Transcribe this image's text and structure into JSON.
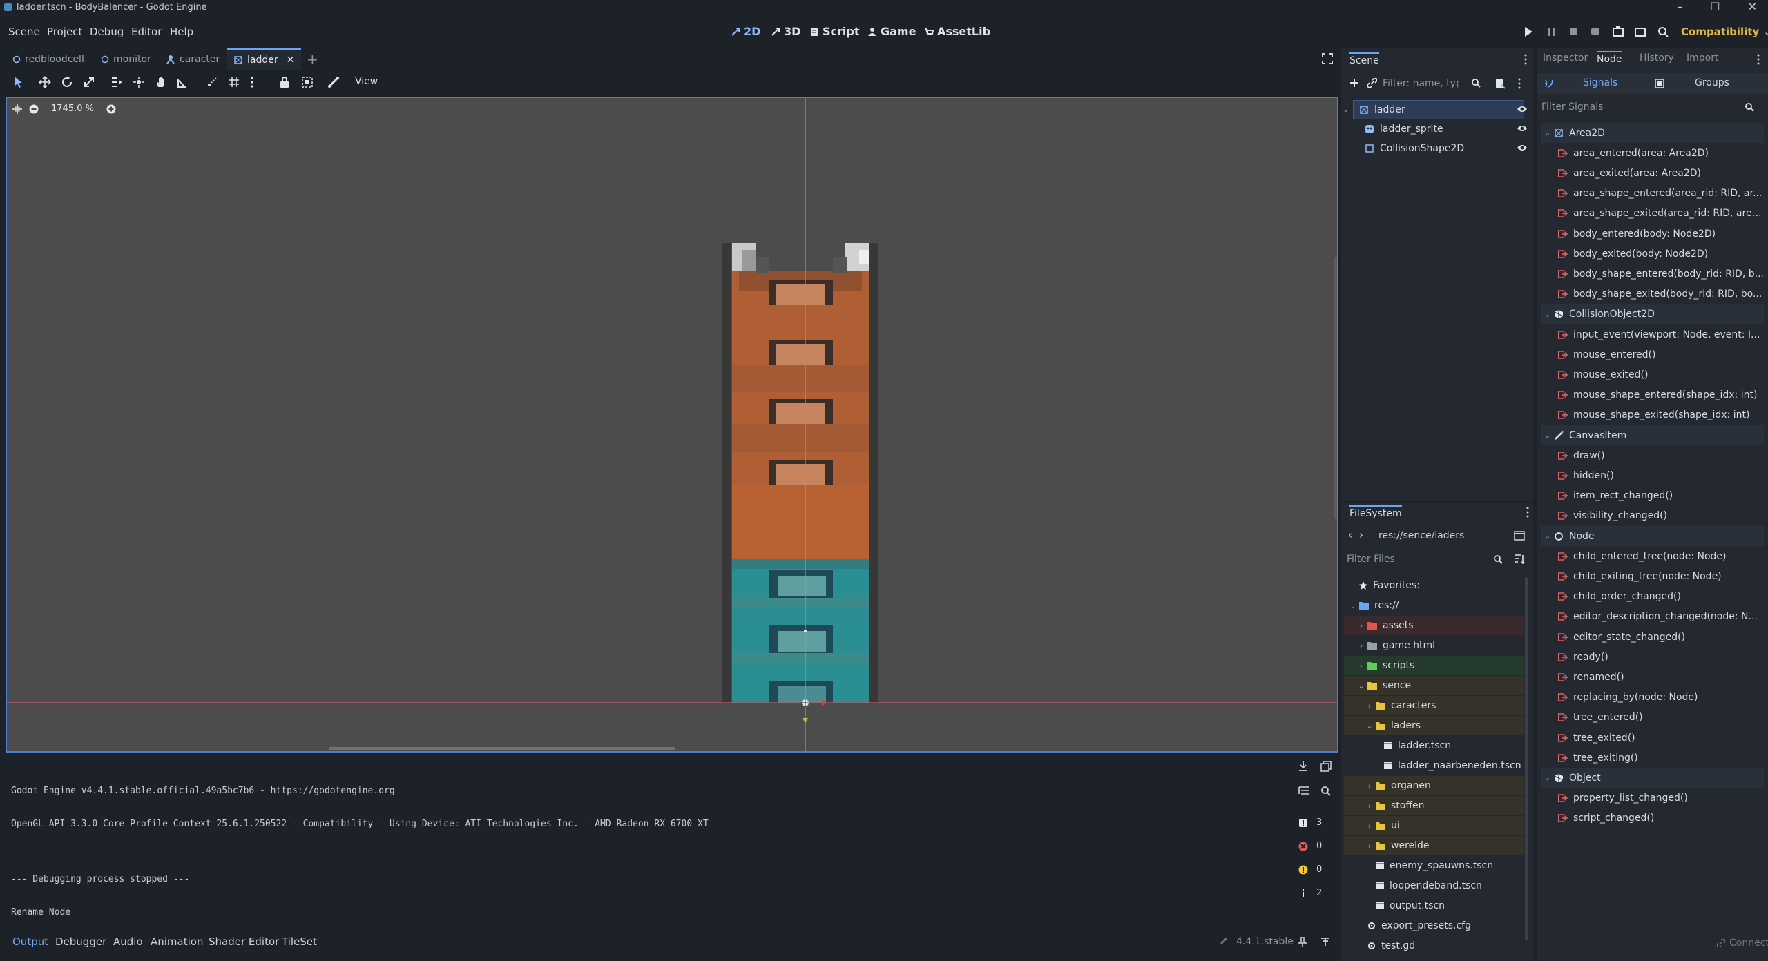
{
  "window": {
    "title": "ladder.tscn - BodyBalencer - Godot Engine",
    "controls": [
      "–",
      "☐",
      "✕"
    ]
  },
  "menubar": {
    "menus": [
      "Scene",
      "Project",
      "Debug",
      "Editor",
      "Help"
    ],
    "workspaces": [
      "2D",
      "3D",
      "Script",
      "Game",
      "AssetLib"
    ],
    "active_workspace": "2D",
    "renderer": "Compatibility"
  },
  "scene_tabs": [
    {
      "label": "redbloodcell",
      "icon": "circle-node-icon"
    },
    {
      "label": "monitor",
      "icon": "circle-node-icon"
    },
    {
      "label": "caracter",
      "icon": "character-body-icon"
    },
    {
      "label": "ladder",
      "icon": "area2d-icon",
      "active": true
    }
  ],
  "toolbar2d": {
    "view_label": "View"
  },
  "viewport": {
    "zoom": "1745.0 %"
  },
  "output": {
    "lines": [
      "Godot Engine v4.4.1.stable.official.49a5bc7b6 - https://godotengine.org",
      "OpenGL API 3.3.0 Core Profile Context 25.6.1.250522 - Compatibility - Using Device: ATI Technologies Inc. - AMD Radeon RX 6700 XT",
      "",
      "--- Debugging process stopped ---",
      "Rename Node"
    ],
    "counts": {
      "messages": "3",
      "errors": "0",
      "warnings": "0",
      "info": "2"
    }
  },
  "bottom_tabs": [
    "Output",
    "Debugger",
    "Audio",
    "Animation",
    "Shader Editor",
    "TileSet"
  ],
  "version": "4.4.1.stable",
  "scene_dock": {
    "title": "Scene",
    "filter_placeholder": "Filter: name, type",
    "nodes": [
      {
        "label": "ladder",
        "icon": "area2d-icon",
        "selected": true
      },
      {
        "label": "ladder_sprite",
        "icon": "sprite2d-icon"
      },
      {
        "label": "CollisionShape2D",
        "icon": "collision-shape-icon"
      }
    ]
  },
  "filesystem": {
    "title": "FileSystem",
    "path": "res://sence/laders",
    "filter_placeholder": "Filter Files",
    "items": [
      {
        "label": "Favorites:",
        "icon": "star-icon",
        "depth": 0
      },
      {
        "label": "res://",
        "icon": "folder-icon",
        "depth": 0,
        "expanded": true
      },
      {
        "label": "assets",
        "icon": "folder-icon",
        "depth": 1,
        "color": "red"
      },
      {
        "label": "game html",
        "icon": "folder-icon",
        "depth": 1,
        "color": "gray"
      },
      {
        "label": "scripts",
        "icon": "folder-icon",
        "depth": 1,
        "color": "green"
      },
      {
        "label": "sence",
        "icon": "folder-icon",
        "depth": 1,
        "color": "yellow",
        "expanded": true
      },
      {
        "label": "caracters",
        "icon": "folder-icon",
        "depth": 2,
        "color": "yellow"
      },
      {
        "label": "laders",
        "icon": "folder-icon",
        "depth": 2,
        "color": "yellow",
        "expanded": true
      },
      {
        "label": "ladder.tscn",
        "icon": "scene-file-icon",
        "depth": 3
      },
      {
        "label": "ladder_naarbeneden.tscn",
        "icon": "scene-file-icon",
        "depth": 3
      },
      {
        "label": "organen",
        "icon": "folder-icon",
        "depth": 2,
        "color": "yellow"
      },
      {
        "label": "stoffen",
        "icon": "folder-icon",
        "depth": 2,
        "color": "yellow"
      },
      {
        "label": "ui",
        "icon": "folder-icon",
        "depth": 2,
        "color": "yellow"
      },
      {
        "label": "werelde",
        "icon": "folder-icon",
        "depth": 2,
        "color": "yellow"
      },
      {
        "label": "enemy_spauwns.tscn",
        "icon": "scene-file-icon",
        "depth": 2
      },
      {
        "label": "loopendeband.tscn",
        "icon": "scene-file-icon",
        "depth": 2
      },
      {
        "label": "output.tscn",
        "icon": "scene-file-icon",
        "depth": 2
      },
      {
        "label": "export_presets.cfg",
        "icon": "gear-icon",
        "depth": 1
      },
      {
        "label": "test.gd",
        "icon": "gear-icon",
        "depth": 1
      }
    ]
  },
  "right_dock": {
    "tabs": [
      "Inspector",
      "Node",
      "History",
      "Import"
    ],
    "active_tab": "Node",
    "subtabs": [
      "Signals",
      "Groups"
    ],
    "filter_placeholder": "Filter Signals",
    "footer": "Connect...",
    "signals": [
      {
        "label": "Area2D",
        "cls": true,
        "icon": "area2d-icon"
      },
      {
        "label": "area_entered(area: Area2D)"
      },
      {
        "label": "area_exited(area: Area2D)"
      },
      {
        "label": "area_shape_entered(area_rid: RID, ar..."
      },
      {
        "label": "area_shape_exited(area_rid: RID, area..."
      },
      {
        "label": "body_entered(body: Node2D)"
      },
      {
        "label": "body_exited(body: Node2D)"
      },
      {
        "label": "body_shape_entered(body_rid: RID, b..."
      },
      {
        "label": "body_shape_exited(body_rid: RID, bo..."
      },
      {
        "label": "CollisionObject2D",
        "cls": true,
        "icon": "collision-object-icon"
      },
      {
        "label": "input_event(viewport: Node, event: I..."
      },
      {
        "label": "mouse_entered()"
      },
      {
        "label": "mouse_exited()"
      },
      {
        "label": "mouse_shape_entered(shape_idx: int)"
      },
      {
        "label": "mouse_shape_exited(shape_idx: int)"
      },
      {
        "label": "CanvasItem",
        "cls": true,
        "icon": "canvas-item-icon"
      },
      {
        "label": "draw()"
      },
      {
        "label": "hidden()"
      },
      {
        "label": "item_rect_changed()"
      },
      {
        "label": "visibility_changed()"
      },
      {
        "label": "Node",
        "cls": true,
        "icon": "node-icon"
      },
      {
        "label": "child_entered_tree(node: Node)"
      },
      {
        "label": "child_exiting_tree(node: Node)"
      },
      {
        "label": "child_order_changed()"
      },
      {
        "label": "editor_description_changed(node: N..."
      },
      {
        "label": "editor_state_changed()"
      },
      {
        "label": "ready()"
      },
      {
        "label": "renamed()"
      },
      {
        "label": "replacing_by(node: Node)"
      },
      {
        "label": "tree_entered()"
      },
      {
        "label": "tree_exited()"
      },
      {
        "label": "tree_exiting()"
      },
      {
        "label": "Object",
        "cls": true,
        "icon": "object-icon"
      },
      {
        "label": "property_list_changed()"
      },
      {
        "label": "script_changed()"
      }
    ]
  }
}
